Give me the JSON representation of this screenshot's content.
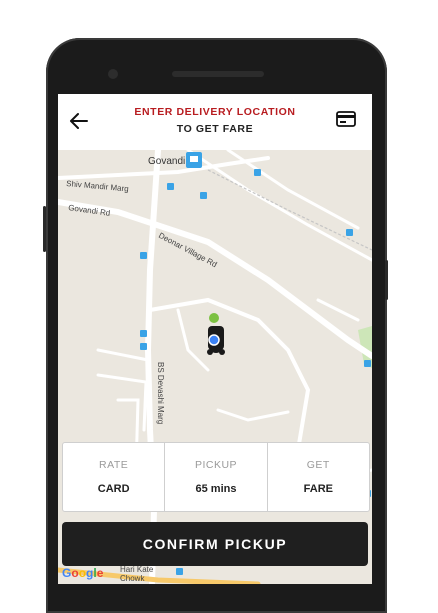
{
  "header": {
    "title_line1": "ENTER DELIVERY LOCATION",
    "title_line2": "TO GET FARE"
  },
  "map": {
    "labels": {
      "govandi": "Govandi",
      "shiv_mandir": "Shiv Mandir Marg",
      "govandi_rd": "Govandi Rd",
      "deonar": "Deonar Village Rd",
      "bs_devashi": "BS Devashi Marg",
      "hari_kate": "Hari Kate",
      "chowk": "Chowk"
    },
    "colors": {
      "land": "#ebe7df",
      "road": "#ffffff",
      "park": "#cde6b8",
      "transit": "#3aa3e6"
    }
  },
  "info": {
    "rate_label": "RATE",
    "rate_value": "CARD",
    "pickup_label": "PICKUP",
    "pickup_value": "65 mins",
    "get_label": "GET",
    "get_value": "FARE"
  },
  "confirm_label": "CONFIRM PICKUP",
  "google": {
    "g1": "G",
    "o1": "o",
    "o2": "o",
    "g2": "g",
    "l": "l",
    "e": "e"
  },
  "colors": {
    "accent": "#b81c20",
    "button": "#1f1f1f"
  }
}
